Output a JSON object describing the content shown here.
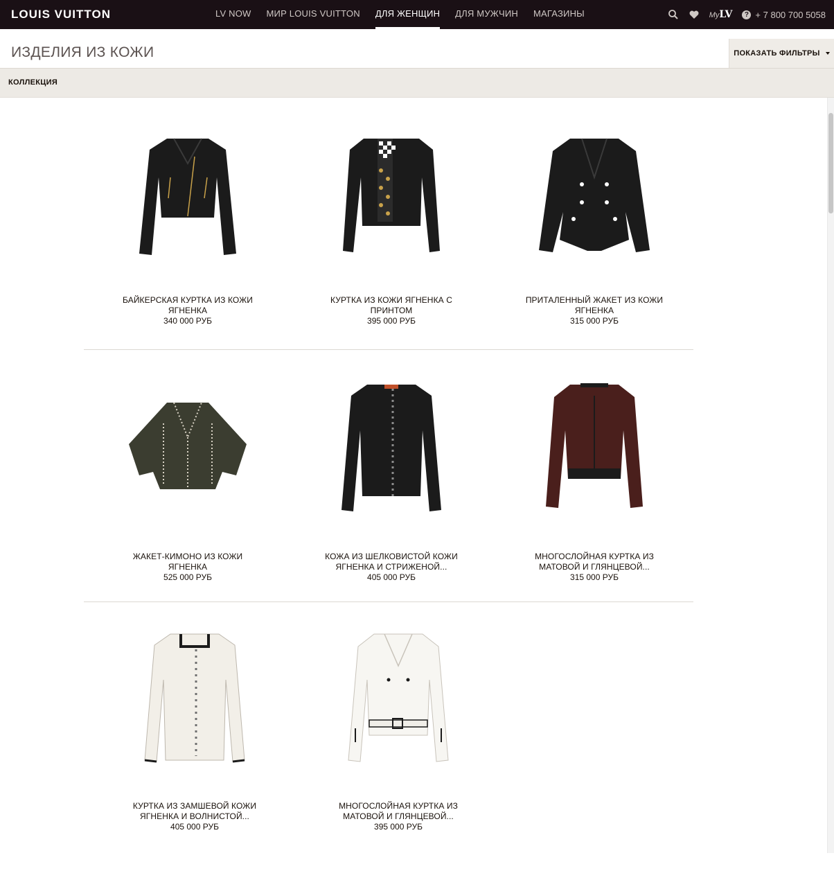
{
  "header": {
    "brand": "LOUIS VUITTON",
    "nav": [
      {
        "label": "LV NOW"
      },
      {
        "label": "МИР LOUIS VUITTON"
      },
      {
        "label": "ДЛЯ ЖЕНЩИН"
      },
      {
        "label": "ДЛЯ МУЖЧИН"
      },
      {
        "label": "МАГАЗИНЫ"
      }
    ],
    "active_nav": "ДЛЯ ЖЕНЩИН",
    "mylv_prefix": "My",
    "mylv_mark": "LV",
    "phone": "+ 7 800 700 5058",
    "icons": [
      "search-icon",
      "heart-icon",
      "mylv-icon",
      "help-icon"
    ]
  },
  "page": {
    "title": "ИЗДЕЛИЯ ИЗ КОЖИ",
    "filters_label": "ПОКАЗАТЬ ФИЛЬТРЫ",
    "collection_label": "КОЛЛЕКЦИЯ"
  },
  "products": [
    {
      "name": "БАЙКЕРСКАЯ КУРТКА ИЗ КОЖИ ЯГНЕНКА",
      "price": "340 000 РУБ",
      "color": "#1b1b1b"
    },
    {
      "name": "КУРТКА ИЗ КОЖИ ЯГНЕНКА С ПРИНТОМ",
      "price": "395 000 РУБ",
      "color": "#1b1b1b"
    },
    {
      "name": "ПРИТАЛЕННЫЙ ЖАКЕТ ИЗ КОЖИ ЯГНЕНКА",
      "price": "315 000 РУБ",
      "color": "#1b1b1b"
    },
    {
      "name": "ЖАКЕТ-КИМОНО ИЗ КОЖИ ЯГНЕНКА",
      "price": "525 000 РУБ",
      "color": "#3b3d30"
    },
    {
      "name": "КОЖА ИЗ ШЕЛКОВИСТОЙ КОЖИ ЯГНЕНКА И СТРИЖЕНОЙ...",
      "price": "405 000 РУБ",
      "color": "#1b1b1b"
    },
    {
      "name": "МНОГОСЛОЙНАЯ КУРТКА ИЗ МАТОВОЙ И ГЛЯНЦЕВОЙ...",
      "price": "315 000 РУБ",
      "color": "#4a1f1c"
    },
    {
      "name": "КУРТКА ИЗ ЗАМШЕВОЙ КОЖИ ЯГНЕНКА И ВОЛНИСТОЙ...",
      "price": "405 000 РУБ",
      "color": "#f2efe8"
    },
    {
      "name": "МНОГОСЛОЙНАЯ КУРТКА ИЗ МАТОВОЙ И ГЛЯНЦЕВОЙ...",
      "price": "395 000 РУБ",
      "color": "#f7f6f2"
    }
  ]
}
